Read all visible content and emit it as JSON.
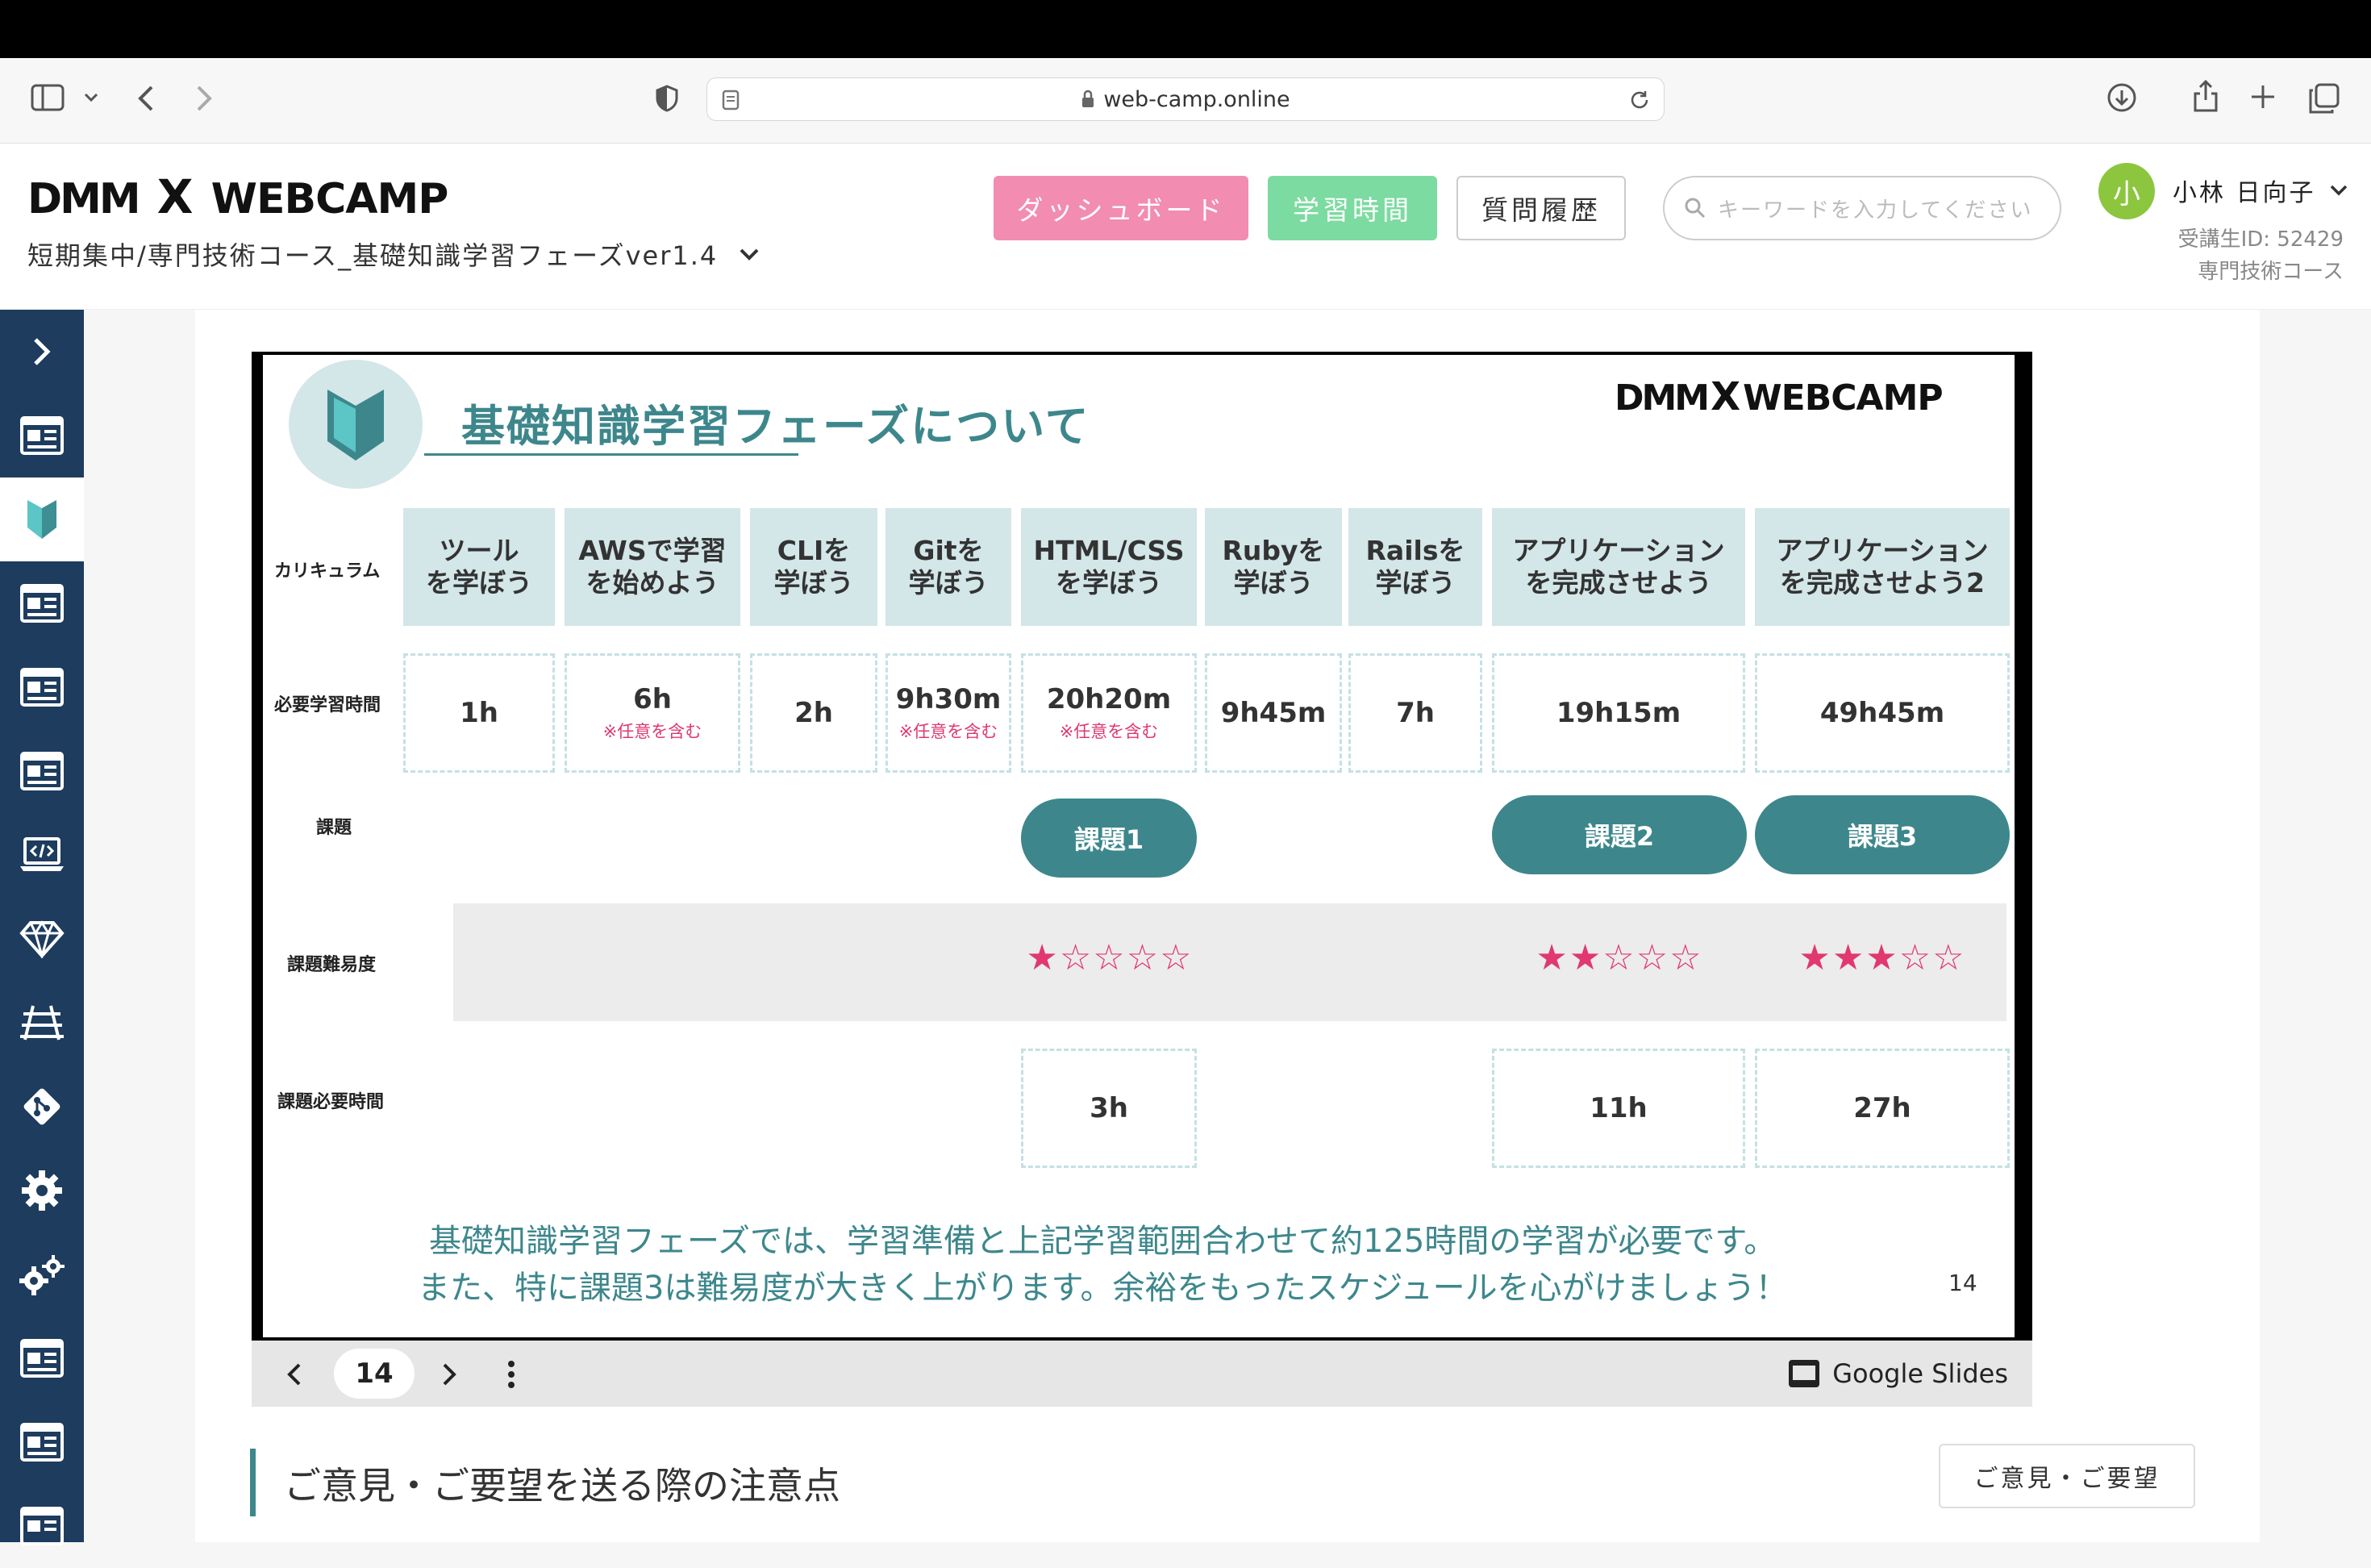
{
  "browser": {
    "url": "web-camp.online"
  },
  "header": {
    "logo": "DMM WEBCAMP",
    "logo_mark": "X",
    "course_selector": "短期集中/専門技術コース_基礎知識学習フェーズver1.4",
    "dashboard_button": "ダッシュボード",
    "study_time_button": "学習時間",
    "question_history_button": "質問履歴",
    "search_placeholder": "キーワードを入力してください",
    "user": {
      "avatar_initial": "小",
      "name": "小林 日向子",
      "student_id": "受講生ID: 52429",
      "course": "専門技術コース"
    },
    "colors": {
      "dashboard": "#f28cb1",
      "study_time": "#7cdba0",
      "avatar": "#8cc63f"
    }
  },
  "sidebar": {
    "items": [
      "chevron-right-icon",
      "newspaper-icon",
      "beginner-mark-icon",
      "newspaper-icon",
      "newspaper-icon",
      "newspaper-icon",
      "laptop-code-icon",
      "gem-icon",
      "rails-icon",
      "git-icon",
      "gear-icon",
      "gears-icon",
      "newspaper-icon",
      "newspaper-icon",
      "newspaper-icon"
    ],
    "bg_color": "#1d3c5e"
  },
  "slide": {
    "title": "基礎知識学習フェーズについて",
    "logo": "DMM WEBCAMP",
    "row_labels": {
      "curriculum": "カリキュラム",
      "required_time": "必要学習時間",
      "assignment": "課題",
      "difficulty": "課題難易度",
      "assignment_time": "課題必要時間"
    },
    "curriculum": [
      {
        "line1": "ツール",
        "line2": "を学ぼう",
        "time": "1h",
        "note": ""
      },
      {
        "line1": "AWSで学習",
        "line2": "を始めよう",
        "time": "6h",
        "note": "※任意を含む"
      },
      {
        "line1": "CLIを",
        "line2": "学ぼう",
        "time": "2h",
        "note": ""
      },
      {
        "line1": "Gitを",
        "line2": "学ぼう",
        "time": "9h30m",
        "note": "※任意を含む"
      },
      {
        "line1": "HTML/CSS",
        "line2": "を学ぼう",
        "time": "20h20m",
        "note": "※任意を含む"
      },
      {
        "line1": "Rubyを",
        "line2": "学ぼう",
        "time": "9h45m",
        "note": ""
      },
      {
        "line1": "Railsを",
        "line2": "学ぼう",
        "time": "7h",
        "note": ""
      },
      {
        "line1": "アプリケーション",
        "line2": "を完成させよう",
        "time": "19h15m",
        "note": ""
      },
      {
        "line1": "アプリケーション",
        "line2": "を完成させよう2",
        "time": "49h45m",
        "note": ""
      }
    ],
    "assignments": [
      {
        "label": "課題1",
        "difficulty": "★☆☆☆☆",
        "difficulty_value": 1,
        "time": "3h"
      },
      {
        "label": "課題2",
        "difficulty": "★★☆☆☆",
        "difficulty_value": 2,
        "time": "11h"
      },
      {
        "label": "課題3",
        "difficulty": "★★★☆☆",
        "difficulty_value": 3,
        "time": "27h"
      }
    ],
    "footer_line1": "基礎知識学習フェーズでは、学習準備と上記学習範囲合わせて約125時間の学習が必要です。",
    "footer_line2": "また、特に課題3は難易度が大きく上がります。余裕をもったスケジュールを心がけましょう！",
    "page_number": "14",
    "colors": {
      "teal": "#3d878c",
      "light_teal": "#d3e6e8",
      "pink": "#e0386f"
    }
  },
  "slide_controls": {
    "current_page": "14",
    "brand": "Google Slides"
  },
  "feedback": {
    "heading": "ご意見・ご要望を送る際の注意点",
    "button": "ご意見・ご要望"
  }
}
